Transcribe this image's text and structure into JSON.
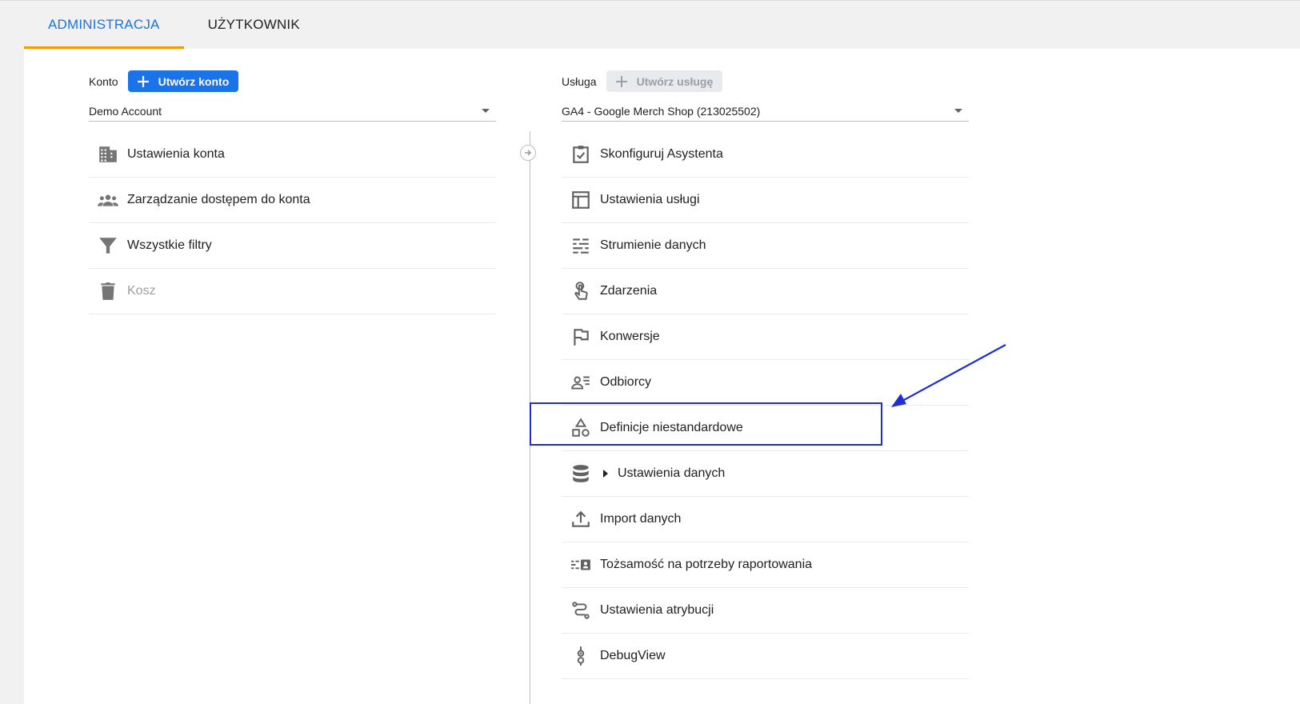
{
  "tabs": [
    {
      "label": "ADMINISTRACJA",
      "active": true
    },
    {
      "label": "UŻYTKOWNIK",
      "active": false
    }
  ],
  "account": {
    "label": "Konto",
    "create_button": "Utwórz konto",
    "selected": "Demo Account",
    "items": [
      {
        "label": "Ustawienia konta",
        "icon": "building-icon",
        "disabled": false
      },
      {
        "label": "Zarządzanie dostępem do konta",
        "icon": "people-icon",
        "disabled": false
      },
      {
        "label": "Wszystkie filtry",
        "icon": "filter-icon",
        "disabled": false
      },
      {
        "label": "Kosz",
        "icon": "trash-icon",
        "disabled": true
      }
    ]
  },
  "property": {
    "label": "Usługa",
    "create_button": "Utwórz usługę",
    "selected": "GA4 - Google Merch Shop (213025502)",
    "items": [
      {
        "label": "Skonfiguruj Asystenta",
        "icon": "checklist-icon"
      },
      {
        "label": "Ustawienia usługi",
        "icon": "property-settings-icon"
      },
      {
        "label": "Strumienie danych",
        "icon": "data-streams-icon"
      },
      {
        "label": "Zdarzenia",
        "icon": "touch-icon"
      },
      {
        "label": "Konwersje",
        "icon": "flag-icon"
      },
      {
        "label": "Odbiorcy",
        "icon": "audience-icon"
      },
      {
        "label": "Definicje niestandardowe",
        "icon": "shapes-icon",
        "highlighted": true
      },
      {
        "label": "Ustawienia danych",
        "icon": "database-icon",
        "expandable": true
      },
      {
        "label": "Import danych",
        "icon": "upload-icon"
      },
      {
        "label": "Tożsamość na potrzeby raportowania",
        "icon": "identity-icon"
      },
      {
        "label": "Ustawienia atrybucji",
        "icon": "attribution-icon"
      },
      {
        "label": "DebugView",
        "icon": "debug-icon"
      }
    ]
  },
  "colors": {
    "accent": "#1a73e8",
    "tab_underline": "#f29900",
    "annotation": "#1f2dd6"
  }
}
